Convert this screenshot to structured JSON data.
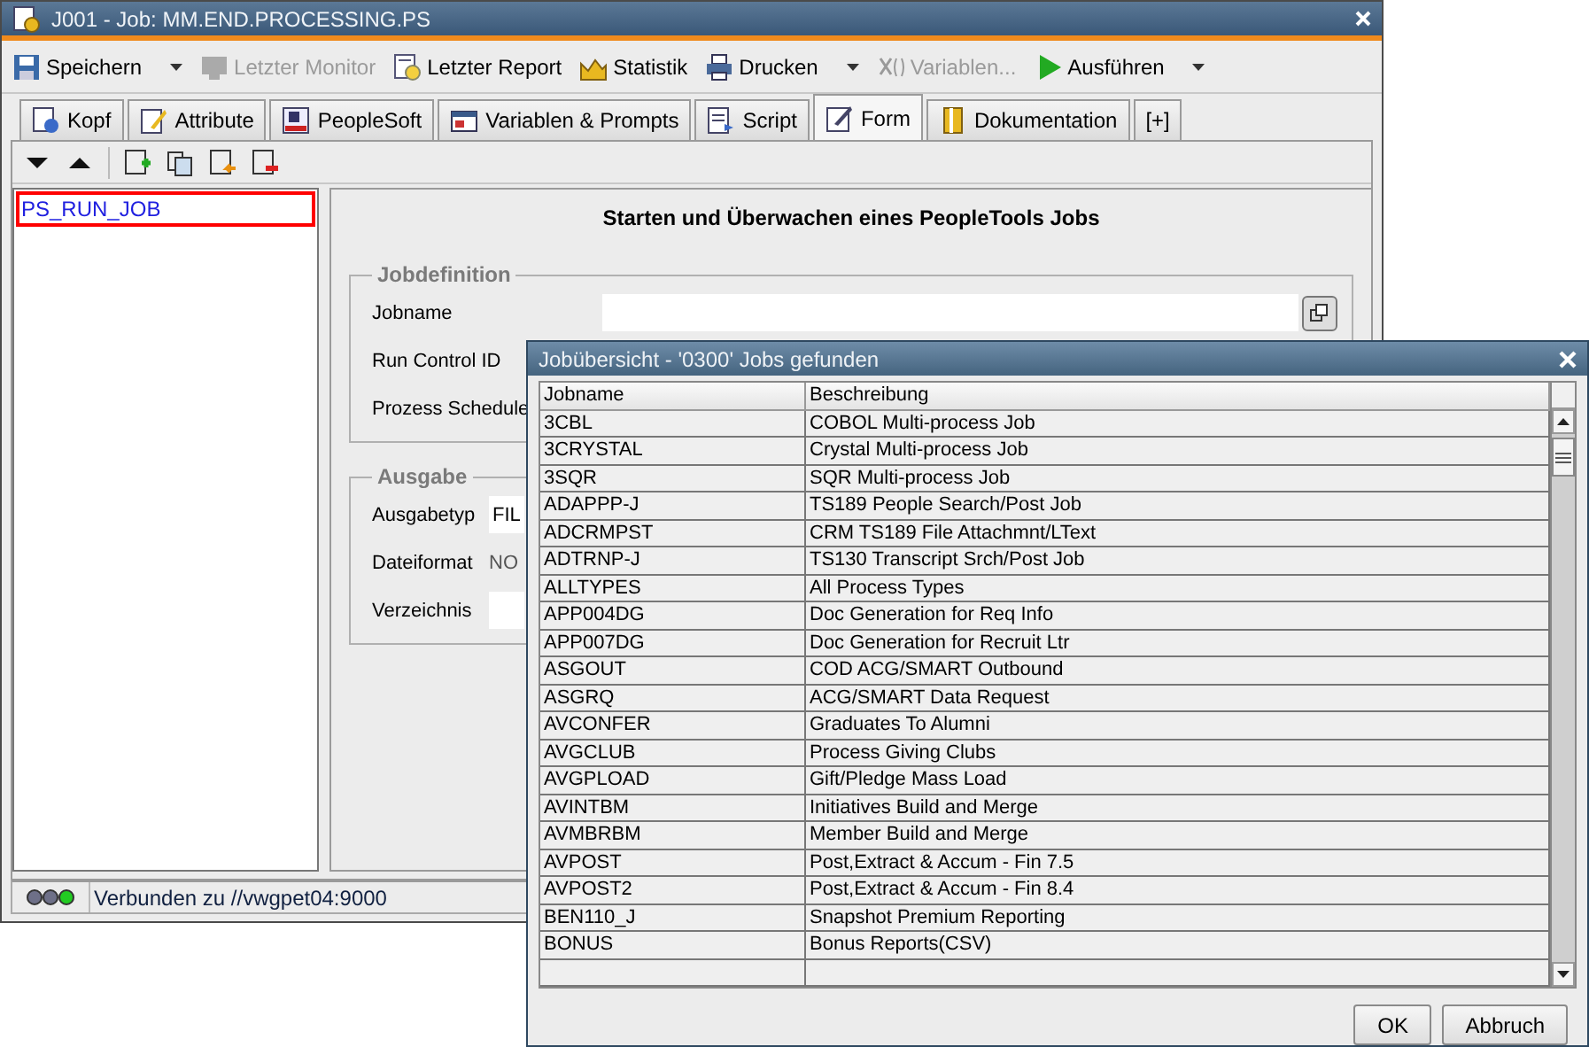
{
  "window": {
    "title": "J001 - Job: MM.END.PROCESSING.PS"
  },
  "toolbar": [
    {
      "label": "Speichern",
      "disabled": false,
      "dropdown": true
    },
    {
      "label": "Letzter Monitor",
      "disabled": true,
      "dropdown": false
    },
    {
      "label": "Letzter Report",
      "disabled": false,
      "dropdown": false
    },
    {
      "label": "Statistik",
      "disabled": false,
      "dropdown": false
    },
    {
      "label": "Drucken",
      "disabled": false,
      "dropdown": true
    },
    {
      "label": "Variablen...",
      "disabled": true,
      "dropdown": false
    },
    {
      "label": "Ausführen",
      "disabled": false,
      "dropdown": true
    }
  ],
  "tabs": [
    {
      "label": "Kopf",
      "selected": false
    },
    {
      "label": "Attribute",
      "selected": false
    },
    {
      "label": "PeopleSoft",
      "selected": false
    },
    {
      "label": "Variablen & Prompts",
      "selected": false
    },
    {
      "label": "Script",
      "selected": false
    },
    {
      "label": "Form",
      "selected": true
    },
    {
      "label": "Dokumentation",
      "selected": false
    },
    {
      "label": "[+]",
      "selected": false
    }
  ],
  "tree": {
    "items": [
      {
        "label": "PS_RUN_JOB",
        "selected": true
      }
    ]
  },
  "form": {
    "heading": "Starten und Überwachen eines PeopleTools Jobs",
    "sections": [
      {
        "title": "Jobdefinition",
        "fields": [
          {
            "label": "Jobname",
            "kind": "lookup"
          },
          {
            "label": "Run Control ID",
            "kind": "covered"
          },
          {
            "label": "Prozess Schedule",
            "kind": "covered"
          }
        ]
      },
      {
        "title": "Ausgabe",
        "fields": [
          {
            "label": "Ausgabetyp",
            "kind": "input",
            "value": "FIL"
          },
          {
            "label": "Dateiformat",
            "kind": "text",
            "value": "NO"
          },
          {
            "label": "Verzeichnis",
            "kind": "input"
          }
        ]
      }
    ]
  },
  "status_bar": {
    "lights": [
      {
        "color": "#6e7088"
      },
      {
        "color": "#6e7088"
      },
      {
        "color": "#22cc22"
      }
    ],
    "text": "Verbunden zu //vwgpet04:9000"
  },
  "dialog": {
    "title": "Jobübersicht - '0300' Jobs gefunden",
    "columns": [
      "Jobname",
      "Beschreibung"
    ],
    "rows": [
      [
        "3CBL",
        "COBOL Multi-process Job"
      ],
      [
        "3CRYSTAL",
        "Crystal Multi-process Job"
      ],
      [
        "3SQR",
        "SQR Multi-process Job"
      ],
      [
        "ADAPPP-J",
        "TS189 People Search/Post Job"
      ],
      [
        "ADCRMPST",
        "CRM TS189 File Attachmnt/LText"
      ],
      [
        "ADTRNP-J",
        "TS130 Transcript Srch/Post Job"
      ],
      [
        "ALLTYPES",
        "All Process Types"
      ],
      [
        "APP004DG",
        "Doc Generation for Req Info"
      ],
      [
        "APP007DG",
        "Doc Generation for Recruit Ltr"
      ],
      [
        "ASGOUT",
        "COD ACG/SMART Outbound"
      ],
      [
        "ASGRQ",
        "ACG/SMART Data Request"
      ],
      [
        "AVCONFER",
        "Graduates To Alumni"
      ],
      [
        "AVGCLUB",
        "Process Giving Clubs"
      ],
      [
        "AVGPLOAD",
        "Gift/Pledge Mass Load"
      ],
      [
        "AVINTBM",
        "Initiatives Build and Merge"
      ],
      [
        "AVMBRBM",
        "Member Build and Merge"
      ],
      [
        "AVPOST",
        "Post,Extract & Accum - Fin 7.5"
      ],
      [
        "AVPOST2",
        "Post,Extract & Accum - Fin 8.4"
      ],
      [
        "BEN110_J",
        "Snapshot Premium Reporting"
      ],
      [
        "BONUS",
        "Bonus Reports(CSV)"
      ]
    ],
    "buttons": [
      "OK",
      "Abbruch"
    ]
  }
}
